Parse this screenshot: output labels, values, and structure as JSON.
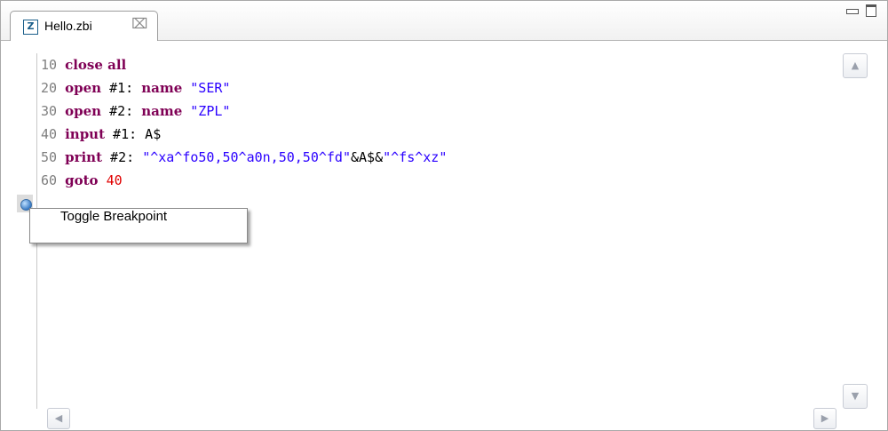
{
  "editor_tab": {
    "icon_letter": "Z",
    "label": "Hello.zbi",
    "close_glyph": "⌧"
  },
  "code_lines": [
    {
      "num": "10",
      "parts": [
        {
          "t": " "
        },
        {
          "t": "close all",
          "c": "kw"
        }
      ]
    },
    {
      "num": "20",
      "parts": [
        {
          "t": " "
        },
        {
          "t": "open",
          "c": "kw"
        },
        {
          "t": " #1: ",
          "c": "plain"
        },
        {
          "t": "name",
          "c": "kw"
        },
        {
          "t": " "
        },
        {
          "t": "\"SER\"",
          "c": "str"
        }
      ]
    },
    {
      "num": "30",
      "parts": [
        {
          "t": " "
        },
        {
          "t": "open",
          "c": "kw"
        },
        {
          "t": " #2: ",
          "c": "plain"
        },
        {
          "t": "name",
          "c": "kw"
        },
        {
          "t": " "
        },
        {
          "t": "\"ZPL\"",
          "c": "str"
        }
      ]
    },
    {
      "num": "40",
      "parts": [
        {
          "t": " "
        },
        {
          "t": "input",
          "c": "kw"
        },
        {
          "t": " #1: A$",
          "c": "plain"
        }
      ]
    },
    {
      "num": "50",
      "parts": [
        {
          "t": " "
        },
        {
          "t": "print",
          "c": "kw"
        },
        {
          "t": " #2: ",
          "c": "plain"
        },
        {
          "t": "\"^xa^fo50,50^a0n,50,50^fd\"",
          "c": "str"
        },
        {
          "t": "&A$&",
          "c": "plain"
        },
        {
          "t": "\"^fs^xz\"",
          "c": "str"
        }
      ]
    },
    {
      "num": "60",
      "parts": [
        {
          "t": " "
        },
        {
          "t": "goto",
          "c": "kw"
        },
        {
          "t": " "
        },
        {
          "t": "40",
          "c": "num"
        }
      ]
    }
  ],
  "context_menu": {
    "items": [
      {
        "label": "Toggle Breakpoint"
      }
    ]
  },
  "scrollbars": {
    "up_glyph": "▲",
    "down_glyph": "▼",
    "left_glyph": "◀",
    "right_glyph": "▶"
  },
  "colors": {
    "keyword": "#7f0055",
    "string": "#2a00ff",
    "number": "#e00000",
    "line_number": "#7f7f7f"
  }
}
